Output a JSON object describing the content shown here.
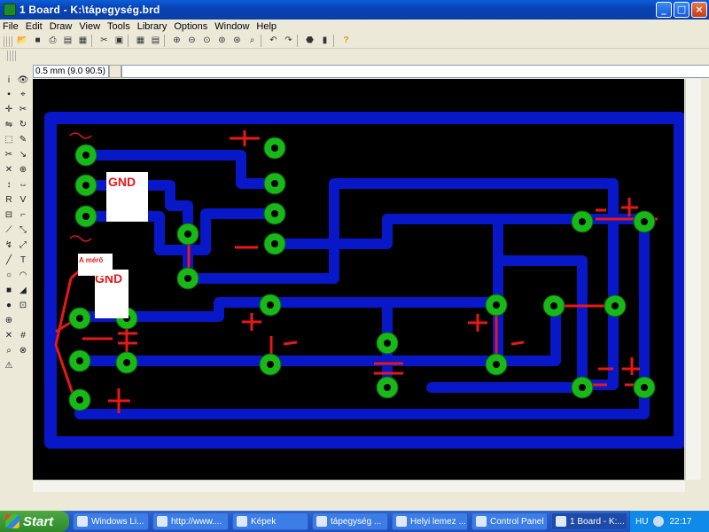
{
  "window": {
    "title": "1 Board - K:\\tápegység.brd"
  },
  "menu": [
    "File",
    "Edit",
    "Draw",
    "View",
    "Tools",
    "Library",
    "Options",
    "Window",
    "Help"
  ],
  "coord": {
    "value": "0.5 mm (9.0 90.5)"
  },
  "canvas": {
    "labels": {
      "gnd1": "GND",
      "gnd2": "GND",
      "meter": "A mérő"
    }
  },
  "taskbar": {
    "start": "Start",
    "tasks": [
      "Windows Li...",
      "http://www....",
      "Képek",
      "tápegység ...",
      "Helyi lemez ...",
      "Control Panel",
      "1 Board - K:..."
    ],
    "lang": "HU",
    "clock": "22:17"
  },
  "colors": {
    "track": "#0818c8",
    "pad": "#18b818",
    "marker": "#e81818",
    "canvas_bg": "#000000"
  }
}
